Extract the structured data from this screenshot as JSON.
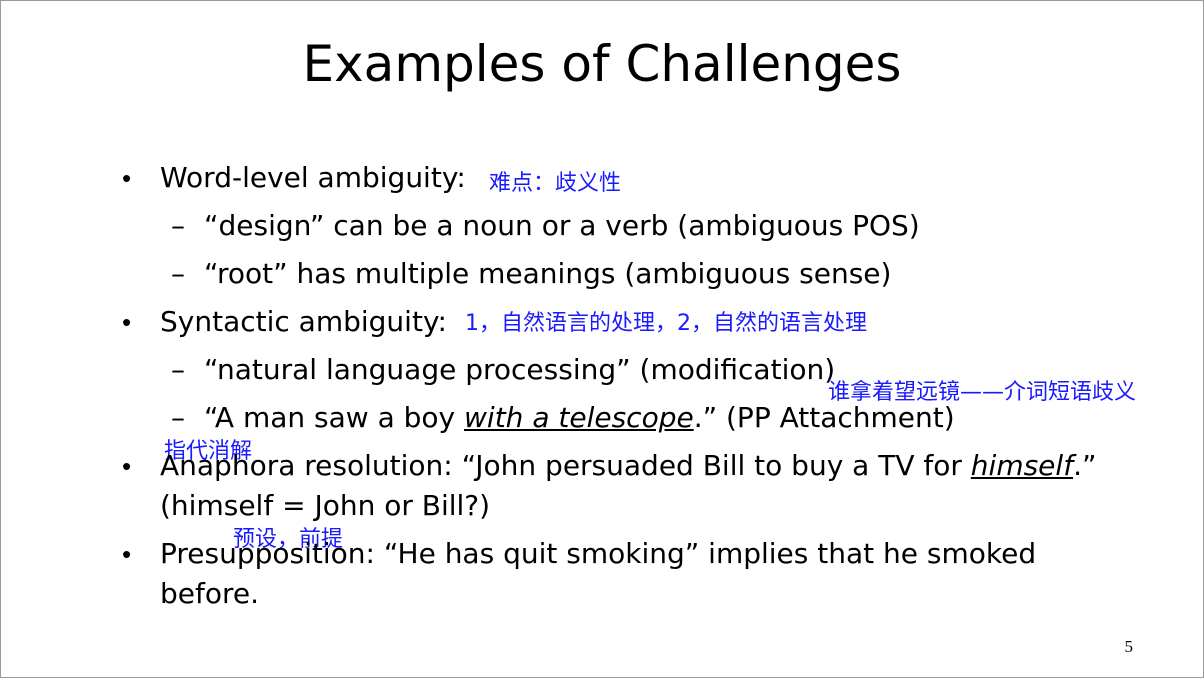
{
  "title": "Examples of Challenges",
  "bullets": {
    "b1": "Word-level ambiguity:",
    "b1_d1": "“design” can be a noun or a verb (ambiguous POS)",
    "b1_d2": "“root” has multiple meanings (ambiguous sense)",
    "b2": "Syntactic ambiguity:",
    "b2_d1": "“natural language processing” (modification)",
    "b2_d2_pre": "“A man saw a boy ",
    "b2_d2_em": "with a telescope",
    "b2_d2_post": ".” (PP Attachment)",
    "b3_l1_pre": "Anaphora resolution: “John persuaded Bill to buy a TV for ",
    "b3_l1_em": "himself",
    "b3_l1_post": ".”",
    "b3_l2": "(himself = John or Bill?)",
    "b4_l1": "Presupposition: “He has quit smoking” implies that he smoked",
    "b4_l2": "before."
  },
  "notes": {
    "n1": "难点：歧义性",
    "n2": "1，自然语言的处理，2，自然的语言处理",
    "n3": "谁拿着望远镜——介词短语歧义",
    "n4": "指代消解",
    "n5": "预设，前提"
  },
  "page_number": "5"
}
